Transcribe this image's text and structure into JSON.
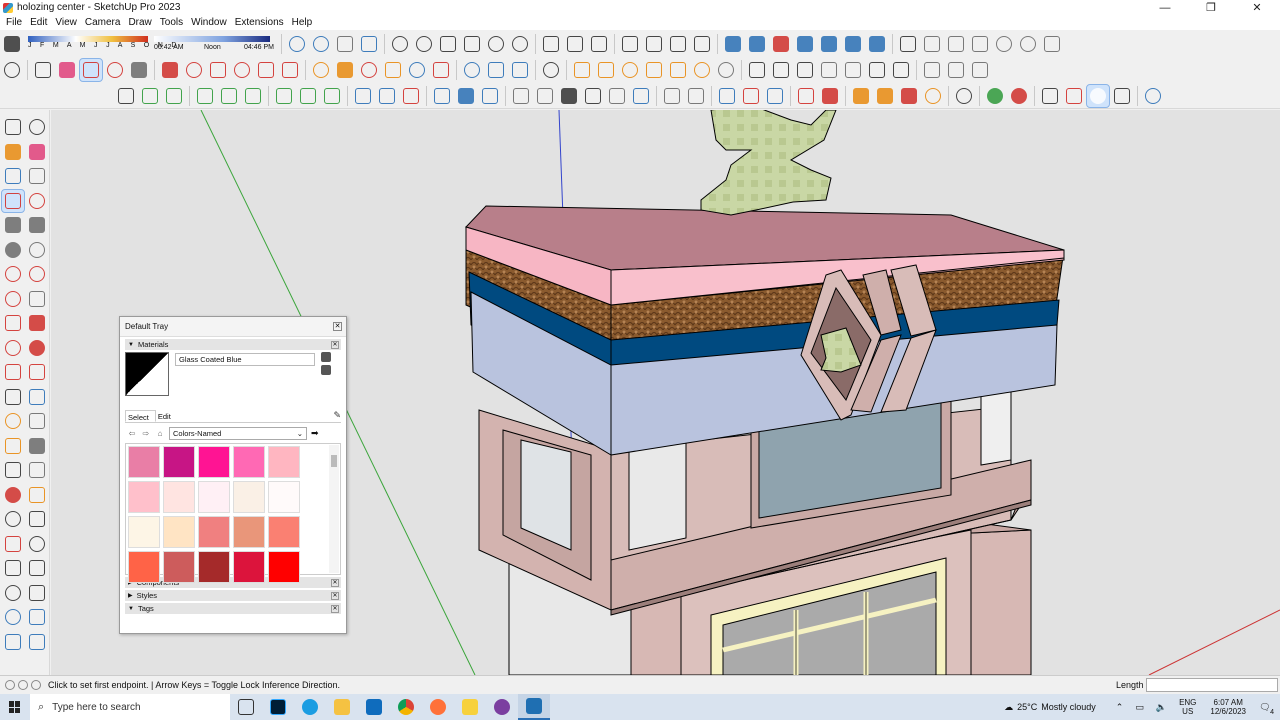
{
  "window": {
    "title": "holozing center - SketchUp Pro 2023",
    "minimize": "—",
    "maximize": "❐",
    "close": "✕"
  },
  "menu": [
    "File",
    "Edit",
    "View",
    "Camera",
    "Draw",
    "Tools",
    "Window",
    "Extensions",
    "Help"
  ],
  "shadow_settings": {
    "months": "J F M A M J J A S O N D",
    "time_start": "06:42 AM",
    "time_mid": "Noon",
    "time_end": "04:46 PM"
  },
  "tray": {
    "title": "Default Tray",
    "close_glyph": "✕",
    "materials_header": "Materials",
    "material_name": "Glass Coated Blue",
    "tabs": {
      "select": "Select",
      "edit": "Edit"
    },
    "library": "Colors-Named",
    "swatches": [
      "#e97ea6",
      "#c71585",
      "#ff1493",
      "#ff69b4",
      "#ffb6c1",
      "#ffc0cb",
      "#ffe4e1",
      "#fff0f5",
      "#faf0e6",
      "#fffafa",
      "#fdf5e6",
      "#ffe4c4",
      "#f08080",
      "#e9967a",
      "#fa8072",
      "#ff6347",
      "#cd5c5c",
      "#a52a2a",
      "#dc143c",
      "#ff0000"
    ],
    "panels": [
      "Components",
      "Styles",
      "Tags"
    ]
  },
  "status": {
    "message": "Click to set first endpoint.  |  Arrow Keys = Toggle Lock Inference Direction.",
    "measurement_label": "Length",
    "measurement_value": ""
  },
  "taskbar": {
    "search_placeholder": "Type here to search",
    "weather_temp": "25°C",
    "weather_text": "Mostly cloudy",
    "language_top": "ENG",
    "language_bottom": "US",
    "time": "6:07 AM",
    "date": "12/6/2023",
    "notification_count": "4"
  },
  "colors": {
    "accent": "#2a6fb5",
    "roof_pink": "#f7b6c4",
    "band_navy": "#004a80",
    "band_lightblue": "#b9c3de",
    "wall": "#d8bcb8"
  }
}
